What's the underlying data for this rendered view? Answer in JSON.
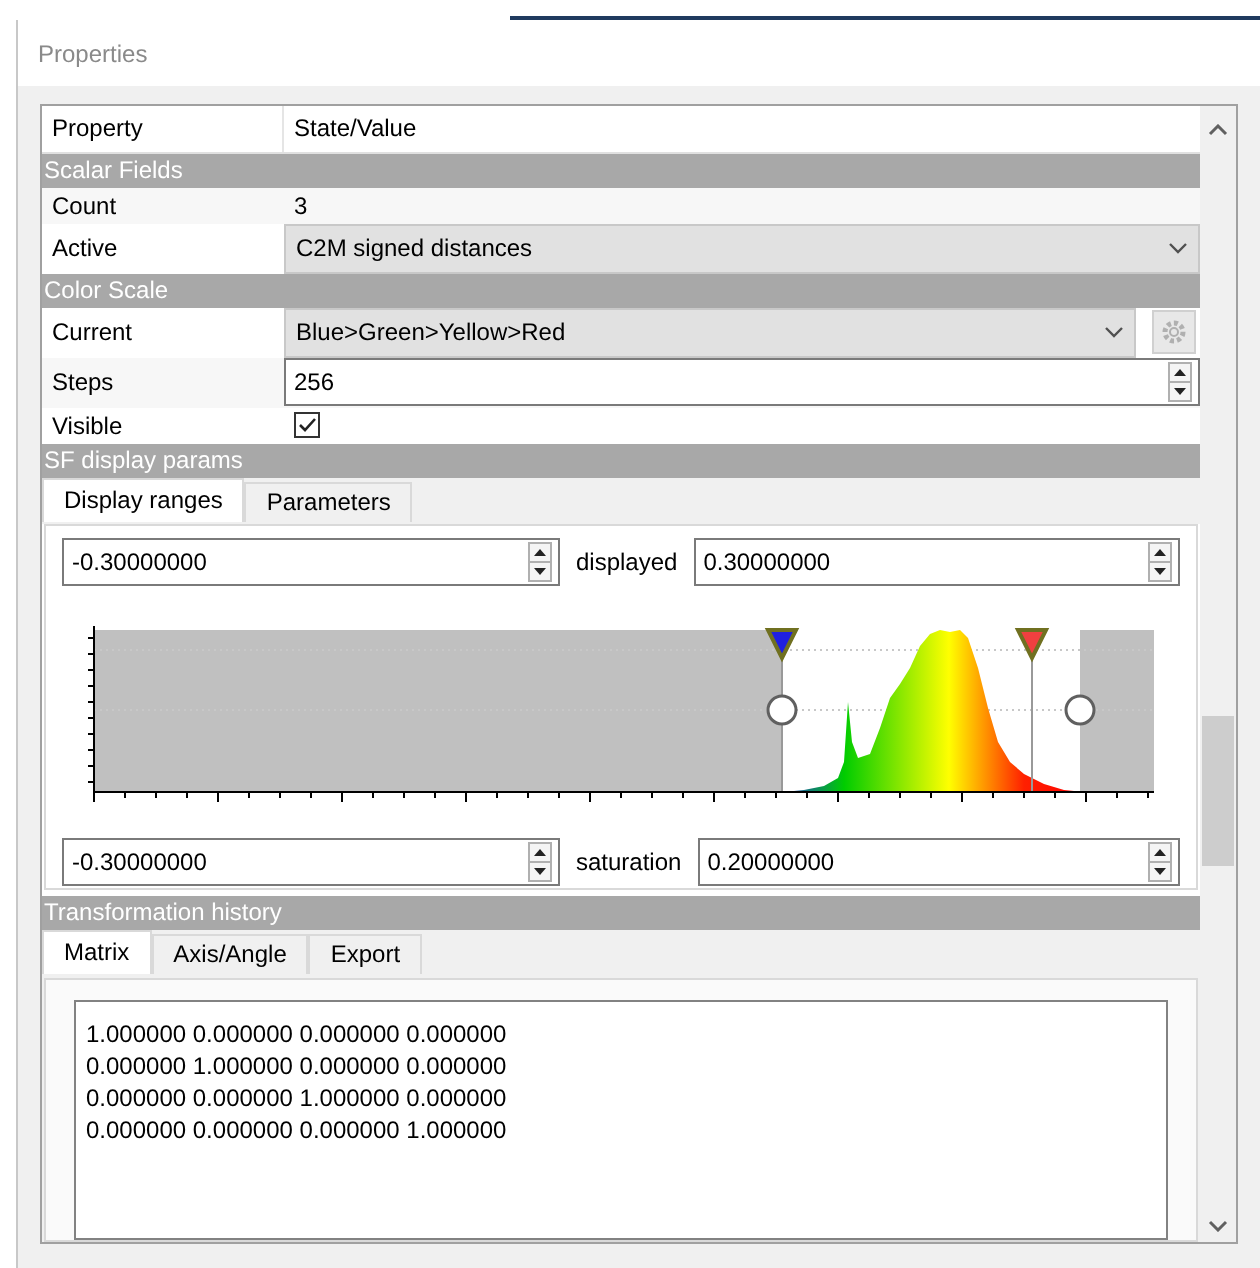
{
  "window": {
    "title": "Properties"
  },
  "table": {
    "columns": [
      "Property",
      "State/Value"
    ],
    "rows": [
      {
        "kind": "section",
        "label": "Scalar Fields"
      },
      {
        "kind": "text",
        "label": "Count",
        "value": "3"
      },
      {
        "kind": "combo",
        "label": "Active",
        "value": "C2M signed distances"
      },
      {
        "kind": "section",
        "label": "Color Scale"
      },
      {
        "kind": "combo_gear",
        "label": "Current",
        "value": "Blue>Green>Yellow>Red"
      },
      {
        "kind": "spin",
        "label": "Steps",
        "value": "256"
      },
      {
        "kind": "check",
        "label": "Visible",
        "checked": true
      },
      {
        "kind": "section",
        "label": "SF display params"
      }
    ]
  },
  "display_tabs": [
    {
      "label": "Display ranges",
      "selected": true
    },
    {
      "label": "Parameters",
      "selected": false
    }
  ],
  "displayed": {
    "min": "-0.30000000",
    "label": "displayed",
    "max": "0.30000000"
  },
  "saturation": {
    "min": "-0.30000000",
    "label": "saturation",
    "max": "0.20000000"
  },
  "transformation_history": {
    "title": "Transformation history",
    "tabs": [
      {
        "label": "Matrix",
        "selected": true
      },
      {
        "label": "Axis/Angle",
        "selected": false
      },
      {
        "label": "Export",
        "selected": false
      }
    ],
    "matrix": [
      "1.000000 0.000000 0.000000 0.000000",
      "0.000000 1.000000 0.000000 0.000000",
      "0.000000 0.000000 1.000000 0.000000",
      "0.000000 0.000000 0.000000 1.000000"
    ]
  }
}
